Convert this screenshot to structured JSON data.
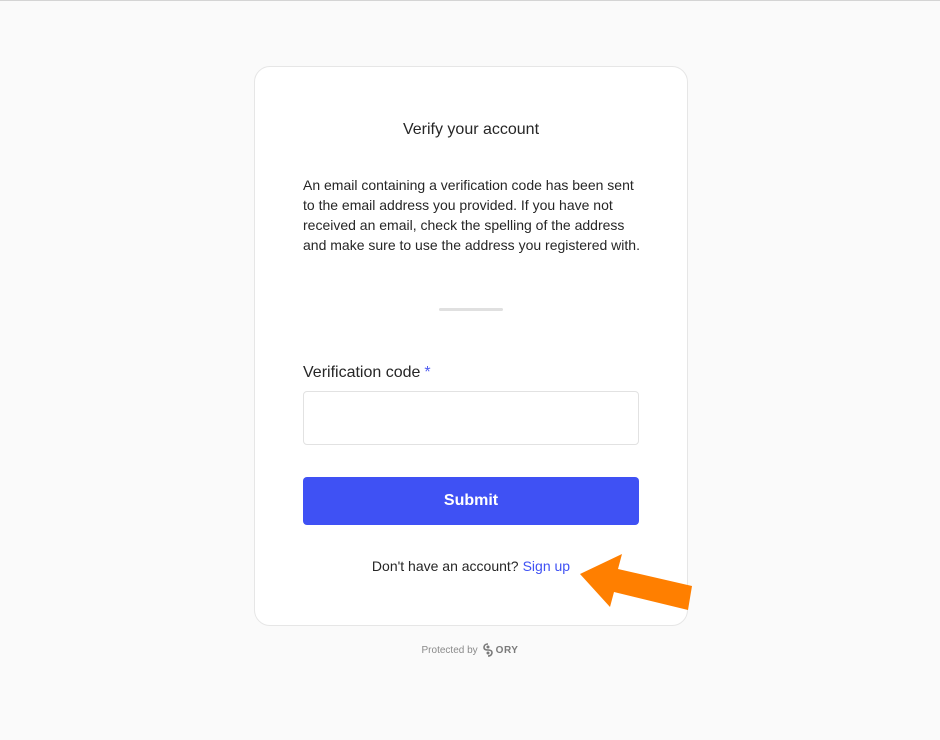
{
  "card": {
    "title": "Verify your account",
    "message": "An email containing a verification code has been sent to the email address you provided. If you have not received an email, check the spelling of the address and make sure to use the address you registered with."
  },
  "form": {
    "code_label": "Verification code",
    "required_mark": "*",
    "code_value": "",
    "code_placeholder": "",
    "submit_label": "Submit"
  },
  "signup": {
    "prompt": "Don't have an account?",
    "link_label": "Sign up"
  },
  "footer": {
    "protected_by": "Protected by",
    "brand": "ORY"
  },
  "colors": {
    "accent": "#3f51f4",
    "annotation_arrow": "#ff7f00"
  },
  "icons": {
    "brand_logo": "ory-logo-icon",
    "annotation": "arrow-pointer-icon"
  }
}
